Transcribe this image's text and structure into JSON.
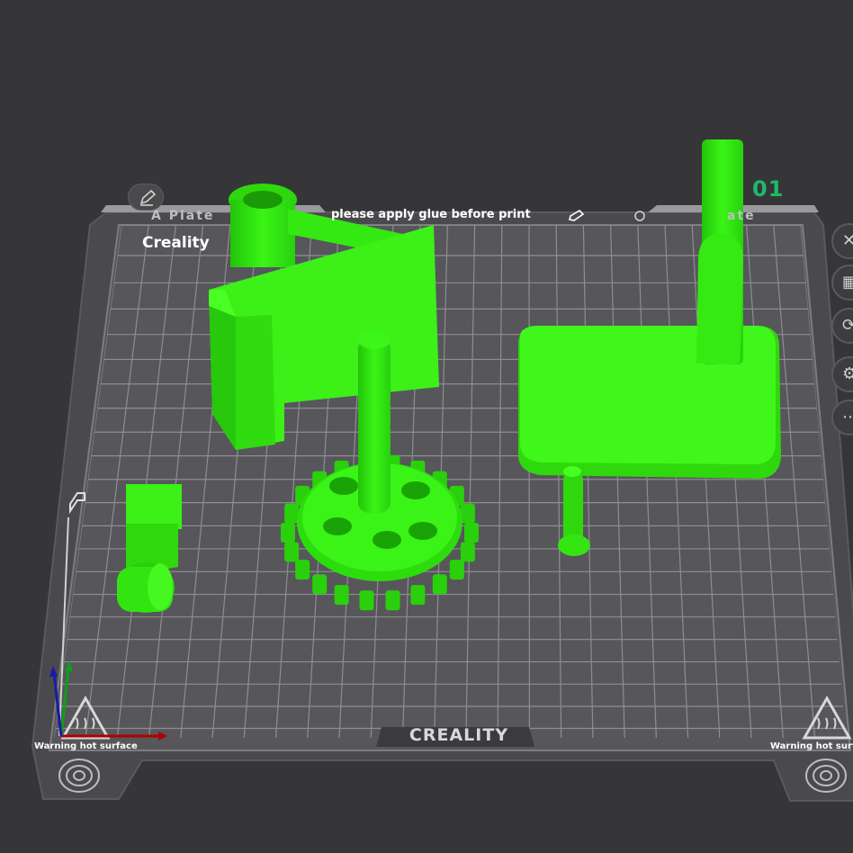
{
  "plate": {
    "name_left": "A Plate",
    "name_right": "ate",
    "number": "01",
    "note": "please apply glue before print",
    "brand_overlay": "Creality",
    "brand_logo": "CREALITY",
    "warning_left": "Warning hot surface",
    "warning_right": "Warning hot surface"
  },
  "colors": {
    "background": "#363638",
    "model_green": "#33ee11",
    "plate_number": "#1fb86a",
    "bed": "#55555a",
    "grid": "#8e8e92"
  },
  "icons": {
    "edit": "pencil-icon",
    "side_buttons": [
      "close-icon",
      "arrange-icon",
      "rotate-icon",
      "settings-icon",
      "more-icon"
    ],
    "bed": [
      "hot-surface-warning-icon",
      "fingerprint-icon",
      "home-icon"
    ]
  }
}
